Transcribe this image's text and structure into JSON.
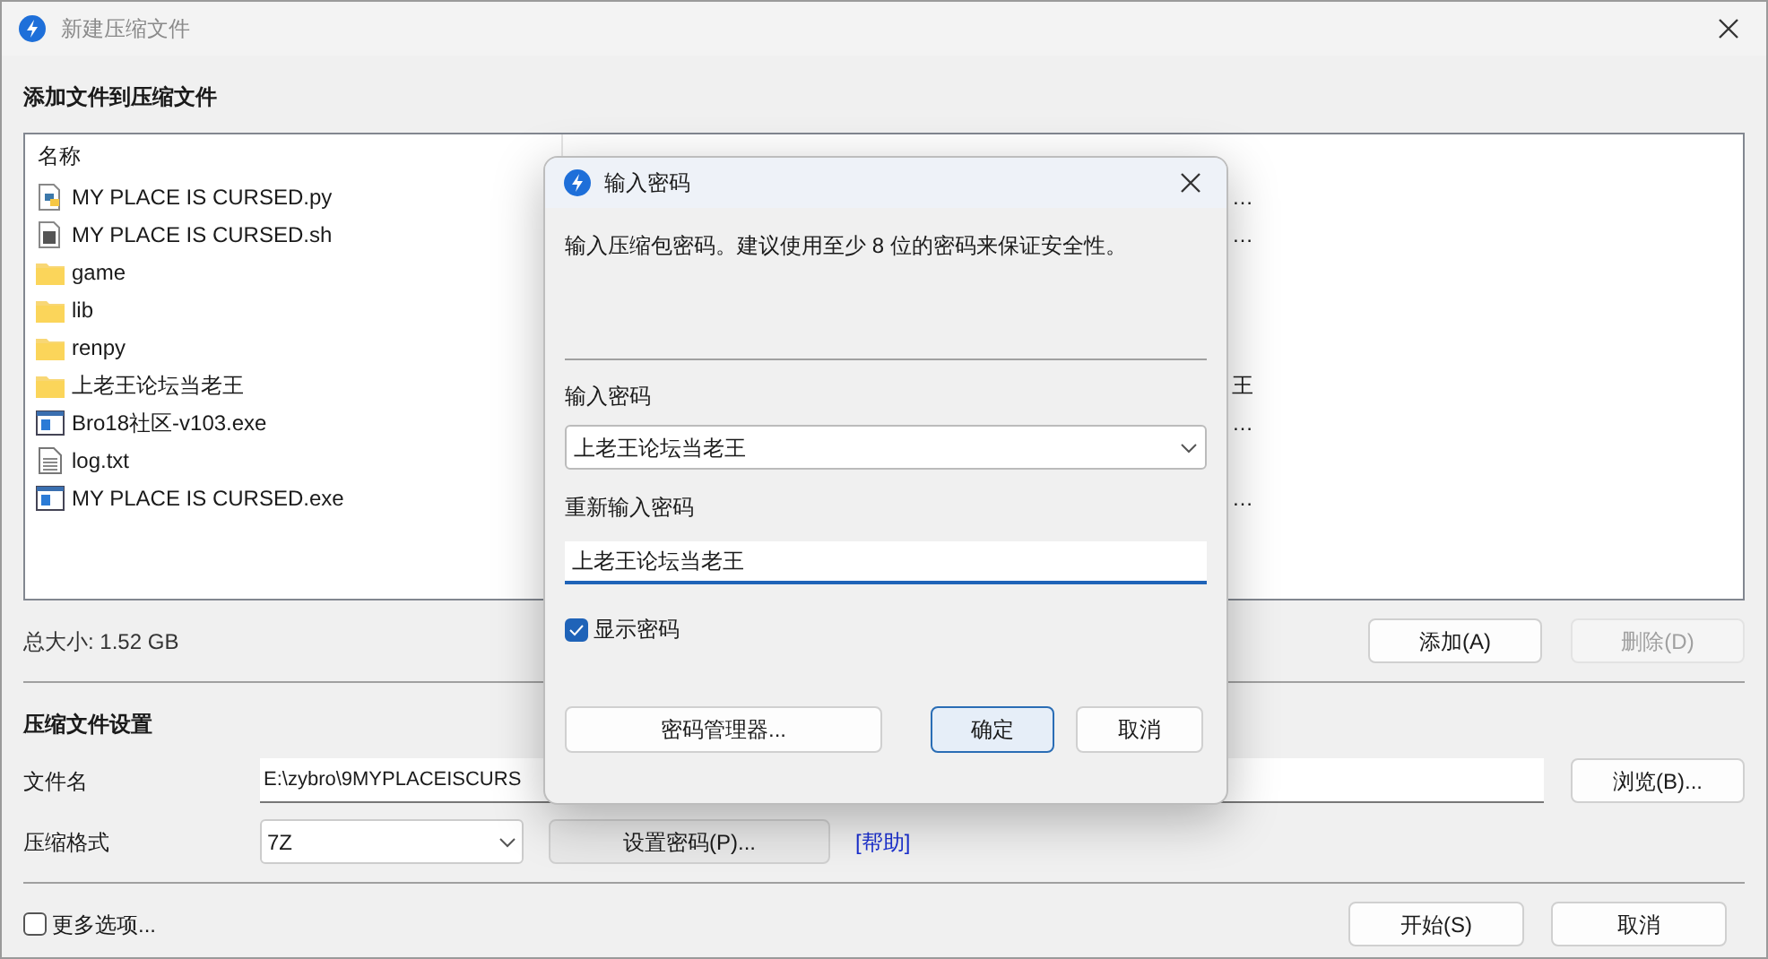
{
  "window": {
    "title": "新建压缩文件",
    "section_title": "添加文件到压缩文件"
  },
  "file_list": {
    "columns": [
      "名称"
    ],
    "rows": [
      {
        "kind": "python",
        "name": "MY PLACE IS CURSED.py",
        "column_3": "…"
      },
      {
        "kind": "script",
        "name": "MY PLACE IS CURSED.sh",
        "column_3": "…"
      },
      {
        "kind": "folder",
        "name": "game"
      },
      {
        "kind": "folder",
        "name": "lib"
      },
      {
        "kind": "folder",
        "name": "renpy"
      },
      {
        "kind": "folder",
        "name": "上老王论坛当老王",
        "column_3": "王"
      },
      {
        "kind": "exe",
        "name": "Bro18社区-v103.exe",
        "column_3": "…"
      },
      {
        "kind": "text",
        "name": "log.txt"
      },
      {
        "kind": "exe",
        "name": "MY PLACE IS CURSED.exe",
        "column_3": "…"
      }
    ]
  },
  "total_size": "总大小: 1.52 GB",
  "list_buttons": [
    {
      "label": "添加(A)",
      "disabled": false
    },
    {
      "label": "删除(D)",
      "disabled": true
    }
  ],
  "settings": {
    "title": "压缩文件设置",
    "filename_label": "文件名",
    "filename": "E:\\zybro\\9MYPLACEISCURS",
    "browse": "浏览(B)...",
    "format_label": "压缩格式",
    "format": "7Z",
    "set_password": "设置密码(P)...",
    "help_link": "[帮助]"
  },
  "more_options": {
    "label": "更多选项...",
    "checked": false
  },
  "footer_buttons": [
    "开始(S)",
    "取消"
  ],
  "password_dialog": {
    "title": "输入密码",
    "message": "输入压缩包密码。建议使用至少 8 位的密码来保证安全性。",
    "password_label": "输入密码",
    "password": "上老王论坛当老王",
    "confirm_label": "重新输入密码",
    "confirm": "上老王论坛当老王",
    "show_password": {
      "label": "显示密码",
      "checked": true
    },
    "manager_button": "密码管理器...",
    "ok_button": "确定",
    "cancel_button": "取消"
  }
}
